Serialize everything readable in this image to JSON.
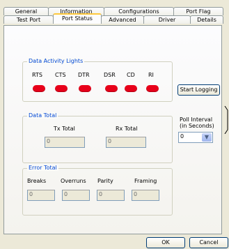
{
  "tabs_row1": [
    "General",
    "Information",
    "Configurations",
    "Port Flag"
  ],
  "tabs_row2": [
    "Test Port",
    "Port Status",
    "Advanced",
    "Driver",
    "Details"
  ],
  "active_tab": "Port Status",
  "data_activity": {
    "title": "Data Activity Lights",
    "labels": [
      "RTS",
      "CTS",
      "DTR",
      "DSR",
      "CD",
      "RI"
    ],
    "led_color": "#e8001a"
  },
  "start_logging_label": "Start Logging",
  "data_total": {
    "title": "Data Total",
    "tx_label": "Tx Total",
    "rx_label": "Rx Total",
    "tx_value": "0",
    "rx_value": "0"
  },
  "poll_interval": {
    "label_line1": "Poll Interval",
    "label_line2": "(in Seconds)",
    "value": "0"
  },
  "error_total": {
    "title": "Error Total",
    "labels": [
      "Breaks",
      "Overruns",
      "Parity",
      "Framing"
    ],
    "values": [
      "0",
      "0",
      "0",
      "0"
    ]
  },
  "footer": {
    "ok_label": "OK",
    "cancel_label": "Cancel"
  }
}
